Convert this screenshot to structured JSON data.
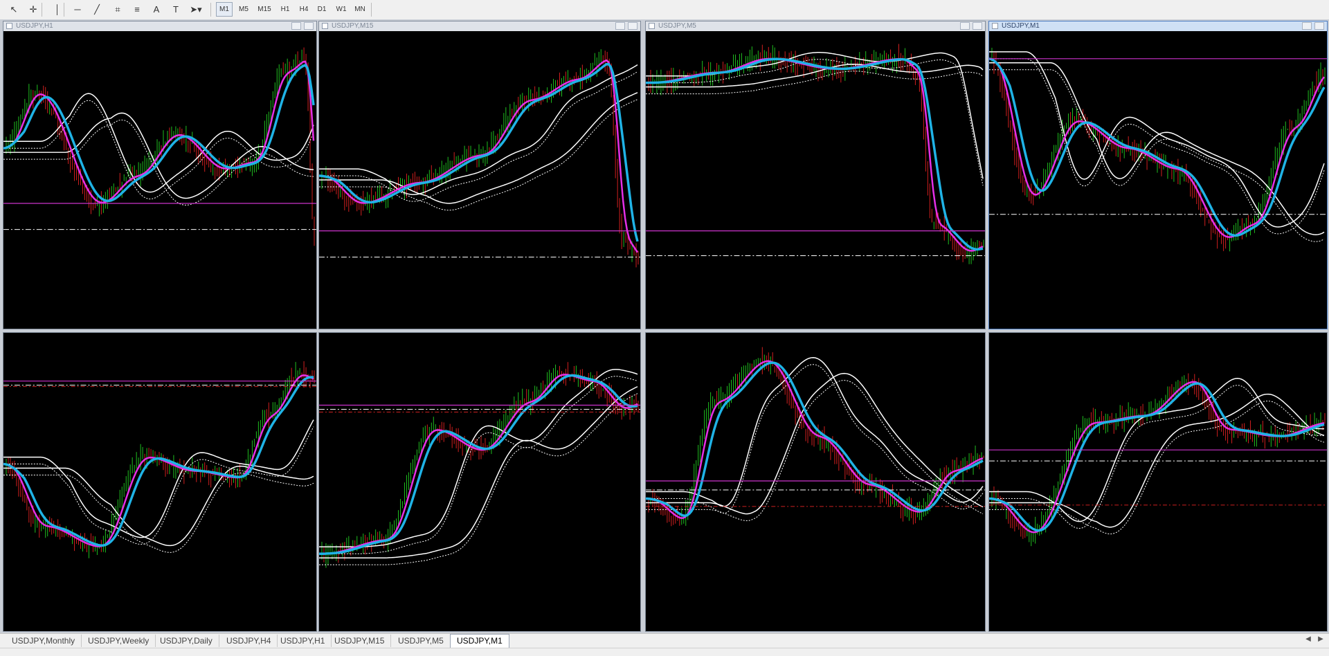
{
  "toolbar": {
    "tools": [
      {
        "name": "cursor-icon",
        "glyph": "↖"
      },
      {
        "name": "crosshair-icon",
        "glyph": "✛"
      },
      {
        "name": "vertical-line-icon",
        "glyph": "│"
      },
      {
        "name": "horizontal-line-icon",
        "glyph": "─"
      },
      {
        "name": "trendline-icon",
        "glyph": "╱"
      },
      {
        "name": "fibonacci-icon",
        "glyph": "⌗"
      },
      {
        "name": "channel-icon",
        "glyph": "≡"
      },
      {
        "name": "text-icon",
        "glyph": "A"
      },
      {
        "name": "text-label-icon",
        "glyph": "T"
      },
      {
        "name": "arrows-menu-icon",
        "glyph": "➤▾"
      }
    ],
    "timeframes": [
      "M1",
      "M5",
      "M15",
      "H1",
      "H4",
      "D1",
      "W1",
      "MN"
    ],
    "active_timeframe": "M1"
  },
  "charts": [
    {
      "title": "USDJPY,H1"
    },
    {
      "title": "USDJPY,M15"
    },
    {
      "title": "USDJPY,M5"
    },
    {
      "title": "USDJPY,M1"
    },
    {
      "title": ""
    },
    {
      "title": ""
    },
    {
      "title": ""
    },
    {
      "title": ""
    }
  ],
  "tabs": [
    "USDJPY,Monthly",
    "USDJPY,Weekly",
    "USDJPY,Daily",
    "USDJPY,H4",
    "USDJPY,H1",
    "USDJPY,M15",
    "USDJPY,M5",
    "USDJPY,M1"
  ],
  "active_tab": "USDJPY,M1",
  "colors": {
    "bull_candle": "#1fbf1f",
    "bear_candle": "#d21f1f",
    "fast_ma": "#e62fe6",
    "slow_ma": "#1fb3e6",
    "envelope": "#ffffff",
    "level_line": "#cc33cc",
    "dashed_level": "#ffffff",
    "red_level": "#cc2020",
    "chart_background": "#000000"
  }
}
